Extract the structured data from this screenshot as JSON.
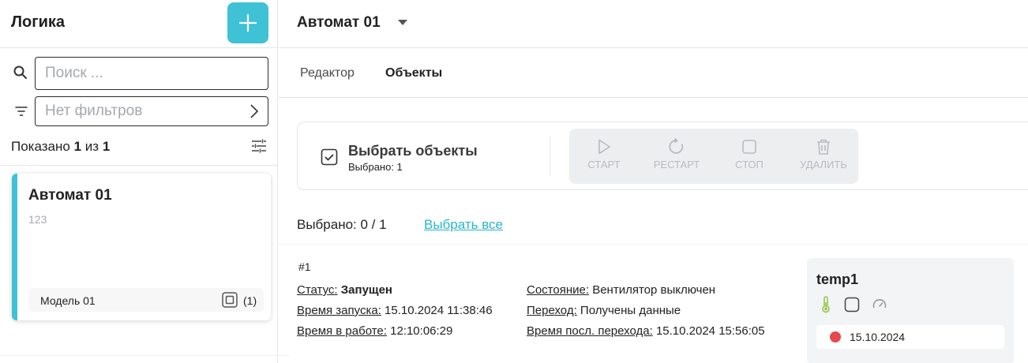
{
  "sidebar": {
    "title": "Логика",
    "add_icon": "plus-icon",
    "search": {
      "placeholder": "Поиск ...",
      "value": ""
    },
    "filter": {
      "placeholder": "Нет фильтров"
    },
    "shown": {
      "prefix": "Показано",
      "count": "1",
      "of": "из",
      "total": "1"
    },
    "items": [
      {
        "title": "Автомат 01",
        "description": "123",
        "model": "Модель 01",
        "count": "(1)"
      }
    ]
  },
  "main": {
    "title": "Автомат 01",
    "tabs": [
      {
        "label": "Редактор",
        "active": false
      },
      {
        "label": "Объекты",
        "active": true
      }
    ],
    "actions": {
      "select_label": "Выбрать объекты",
      "selected_label": "Выбрано: 1",
      "buttons": [
        {
          "label": "СТАРТ",
          "icon": "play-icon"
        },
        {
          "label": "РЕСТАРТ",
          "icon": "restart-icon"
        },
        {
          "label": "СТОП",
          "icon": "stop-icon"
        },
        {
          "label": "УДАЛИТЬ",
          "icon": "trash-icon"
        }
      ]
    },
    "selection": {
      "summary": "Выбрано: 0 / 1",
      "select_all": "Выбрать все"
    },
    "objects": [
      {
        "number": "#1",
        "status_label": "Статус:",
        "status_value": "Запущен",
        "launch_label": "Время запуска:",
        "launch_value": "15.10.2024 11:38:46",
        "runtime_label": "Время в работе:",
        "runtime_value": "12:10:06:29",
        "state_label": "Состояние:",
        "state_value": "Вентилятор выключен",
        "transition_label": "Переход:",
        "transition_value": "Получены данные",
        "last_transition_label": "Время посл. перехода:",
        "last_transition_value": "15.10.2024 15:56:05",
        "sensor": {
          "name": "temp1",
          "icons": [
            "thermometer-icon",
            "square-icon",
            "gauge-icon"
          ],
          "date": "15.10.2024",
          "status_color": "#e8474c"
        }
      }
    ]
  },
  "colors": {
    "accent": "#3fc2d6",
    "link": "#27b6cc",
    "disabled": "#b8bcc1",
    "alert": "#e8474c"
  }
}
